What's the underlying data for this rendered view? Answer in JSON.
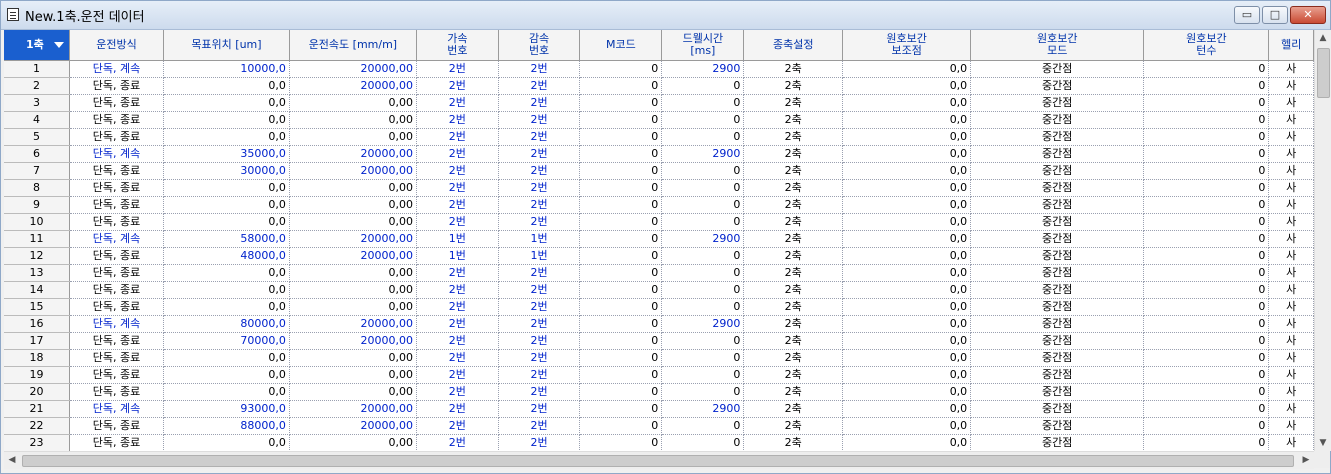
{
  "window": {
    "title": "New.1축.운전 데이터",
    "minimize_label": "▭",
    "maximize_label": "□",
    "close_label": "✕"
  },
  "grid": {
    "axis_selector": "1축",
    "columns": [
      {
        "key": "method",
        "label": [
          "운전방식"
        ]
      },
      {
        "key": "target",
        "label": [
          "목표위치 [um]"
        ]
      },
      {
        "key": "speed",
        "label": [
          "운전속도 [mm/m]"
        ]
      },
      {
        "key": "accel",
        "label": [
          "가속",
          "번호"
        ]
      },
      {
        "key": "decel",
        "label": [
          "감속",
          "번호"
        ]
      },
      {
        "key": "mcode",
        "label": [
          "M코드"
        ]
      },
      {
        "key": "dwell",
        "label": [
          "드웰시간",
          "[ms]"
        ]
      },
      {
        "key": "axisset",
        "label": [
          "종축설정"
        ]
      },
      {
        "key": "auxpt",
        "label": [
          "원호보간",
          "보조점"
        ]
      },
      {
        "key": "mode",
        "label": [
          "원호보간",
          "모드"
        ]
      },
      {
        "key": "turns",
        "label": [
          "원호보간",
          "턴수"
        ]
      },
      {
        "key": "helix",
        "label": [
          "헬리"
        ]
      }
    ],
    "rows": [
      {
        "no": "1",
        "method": "단독, 계속",
        "target": "10000,0",
        "speed": "20000,00",
        "accel": "2번",
        "decel": "2번",
        "mcode": "0",
        "dwell": "2900",
        "axisset": "2축",
        "auxpt": "0,0",
        "mode": "중간점",
        "turns": "0",
        "helix": "사"
      },
      {
        "no": "2",
        "method": "단독, 종료",
        "target": "0,0",
        "speed": "20000,00",
        "accel": "2번",
        "decel": "2번",
        "mcode": "0",
        "dwell": "0",
        "axisset": "2축",
        "auxpt": "0,0",
        "mode": "중간점",
        "turns": "0",
        "helix": "사"
      },
      {
        "no": "3",
        "method": "단독, 종료",
        "target": "0,0",
        "speed": "0,00",
        "accel": "2번",
        "decel": "2번",
        "mcode": "0",
        "dwell": "0",
        "axisset": "2축",
        "auxpt": "0,0",
        "mode": "중간점",
        "turns": "0",
        "helix": "사"
      },
      {
        "no": "4",
        "method": "단독, 종료",
        "target": "0,0",
        "speed": "0,00",
        "accel": "2번",
        "decel": "2번",
        "mcode": "0",
        "dwell": "0",
        "axisset": "2축",
        "auxpt": "0,0",
        "mode": "중간점",
        "turns": "0",
        "helix": "사"
      },
      {
        "no": "5",
        "method": "단독, 종료",
        "target": "0,0",
        "speed": "0,00",
        "accel": "2번",
        "decel": "2번",
        "mcode": "0",
        "dwell": "0",
        "axisset": "2축",
        "auxpt": "0,0",
        "mode": "중간점",
        "turns": "0",
        "helix": "사"
      },
      {
        "no": "6",
        "method": "단독, 계속",
        "target": "35000,0",
        "speed": "20000,00",
        "accel": "2번",
        "decel": "2번",
        "mcode": "0",
        "dwell": "2900",
        "axisset": "2축",
        "auxpt": "0,0",
        "mode": "중간점",
        "turns": "0",
        "helix": "사"
      },
      {
        "no": "7",
        "method": "단독, 종료",
        "target": "30000,0",
        "speed": "20000,00",
        "accel": "2번",
        "decel": "2번",
        "mcode": "0",
        "dwell": "0",
        "axisset": "2축",
        "auxpt": "0,0",
        "mode": "중간점",
        "turns": "0",
        "helix": "사"
      },
      {
        "no": "8",
        "method": "단독, 종료",
        "target": "0,0",
        "speed": "0,00",
        "accel": "2번",
        "decel": "2번",
        "mcode": "0",
        "dwell": "0",
        "axisset": "2축",
        "auxpt": "0,0",
        "mode": "중간점",
        "turns": "0",
        "helix": "사"
      },
      {
        "no": "9",
        "method": "단독, 종료",
        "target": "0,0",
        "speed": "0,00",
        "accel": "2번",
        "decel": "2번",
        "mcode": "0",
        "dwell": "0",
        "axisset": "2축",
        "auxpt": "0,0",
        "mode": "중간점",
        "turns": "0",
        "helix": "사"
      },
      {
        "no": "10",
        "method": "단독, 종료",
        "target": "0,0",
        "speed": "0,00",
        "accel": "2번",
        "decel": "2번",
        "mcode": "0",
        "dwell": "0",
        "axisset": "2축",
        "auxpt": "0,0",
        "mode": "중간점",
        "turns": "0",
        "helix": "사"
      },
      {
        "no": "11",
        "method": "단독, 계속",
        "target": "58000,0",
        "speed": "20000,00",
        "accel": "1번",
        "decel": "1번",
        "mcode": "0",
        "dwell": "2900",
        "axisset": "2축",
        "auxpt": "0,0",
        "mode": "중간점",
        "turns": "0",
        "helix": "사"
      },
      {
        "no": "12",
        "method": "단독, 종료",
        "target": "48000,0",
        "speed": "20000,00",
        "accel": "1번",
        "decel": "1번",
        "mcode": "0",
        "dwell": "0",
        "axisset": "2축",
        "auxpt": "0,0",
        "mode": "중간점",
        "turns": "0",
        "helix": "사"
      },
      {
        "no": "13",
        "method": "단독, 종료",
        "target": "0,0",
        "speed": "0,00",
        "accel": "2번",
        "decel": "2번",
        "mcode": "0",
        "dwell": "0",
        "axisset": "2축",
        "auxpt": "0,0",
        "mode": "중간점",
        "turns": "0",
        "helix": "사"
      },
      {
        "no": "14",
        "method": "단독, 종료",
        "target": "0,0",
        "speed": "0,00",
        "accel": "2번",
        "decel": "2번",
        "mcode": "0",
        "dwell": "0",
        "axisset": "2축",
        "auxpt": "0,0",
        "mode": "중간점",
        "turns": "0",
        "helix": "사"
      },
      {
        "no": "15",
        "method": "단독, 종료",
        "target": "0,0",
        "speed": "0,00",
        "accel": "2번",
        "decel": "2번",
        "mcode": "0",
        "dwell": "0",
        "axisset": "2축",
        "auxpt": "0,0",
        "mode": "중간점",
        "turns": "0",
        "helix": "사"
      },
      {
        "no": "16",
        "method": "단독, 계속",
        "target": "80000,0",
        "speed": "20000,00",
        "accel": "2번",
        "decel": "2번",
        "mcode": "0",
        "dwell": "2900",
        "axisset": "2축",
        "auxpt": "0,0",
        "mode": "중간점",
        "turns": "0",
        "helix": "사"
      },
      {
        "no": "17",
        "method": "단독, 종료",
        "target": "70000,0",
        "speed": "20000,00",
        "accel": "2번",
        "decel": "2번",
        "mcode": "0",
        "dwell": "0",
        "axisset": "2축",
        "auxpt": "0,0",
        "mode": "중간점",
        "turns": "0",
        "helix": "사"
      },
      {
        "no": "18",
        "method": "단독, 종료",
        "target": "0,0",
        "speed": "0,00",
        "accel": "2번",
        "decel": "2번",
        "mcode": "0",
        "dwell": "0",
        "axisset": "2축",
        "auxpt": "0,0",
        "mode": "중간점",
        "turns": "0",
        "helix": "사"
      },
      {
        "no": "19",
        "method": "단독, 종료",
        "target": "0,0",
        "speed": "0,00",
        "accel": "2번",
        "decel": "2번",
        "mcode": "0",
        "dwell": "0",
        "axisset": "2축",
        "auxpt": "0,0",
        "mode": "중간점",
        "turns": "0",
        "helix": "사"
      },
      {
        "no": "20",
        "method": "단독, 종료",
        "target": "0,0",
        "speed": "0,00",
        "accel": "2번",
        "decel": "2번",
        "mcode": "0",
        "dwell": "0",
        "axisset": "2축",
        "auxpt": "0,0",
        "mode": "중간점",
        "turns": "0",
        "helix": "사"
      },
      {
        "no": "21",
        "method": "단독, 계속",
        "target": "93000,0",
        "speed": "20000,00",
        "accel": "2번",
        "decel": "2번",
        "mcode": "0",
        "dwell": "2900",
        "axisset": "2축",
        "auxpt": "0,0",
        "mode": "중간점",
        "turns": "0",
        "helix": "사"
      },
      {
        "no": "22",
        "method": "단독, 종료",
        "target": "88000,0",
        "speed": "20000,00",
        "accel": "2번",
        "decel": "2번",
        "mcode": "0",
        "dwell": "0",
        "axisset": "2축",
        "auxpt": "0,0",
        "mode": "중간점",
        "turns": "0",
        "helix": "사"
      },
      {
        "no": "23",
        "method": "단독, 종료",
        "target": "0,0",
        "speed": "0,00",
        "accel": "2번",
        "decel": "2번",
        "mcode": "0",
        "dwell": "0",
        "axisset": "2축",
        "auxpt": "0,0",
        "mode": "중간점",
        "turns": "0",
        "helix": "사"
      }
    ]
  },
  "colors": {
    "header_selected": "#1a5fcf",
    "value_blue": "#0022cc",
    "header_text": "#0033aa"
  }
}
